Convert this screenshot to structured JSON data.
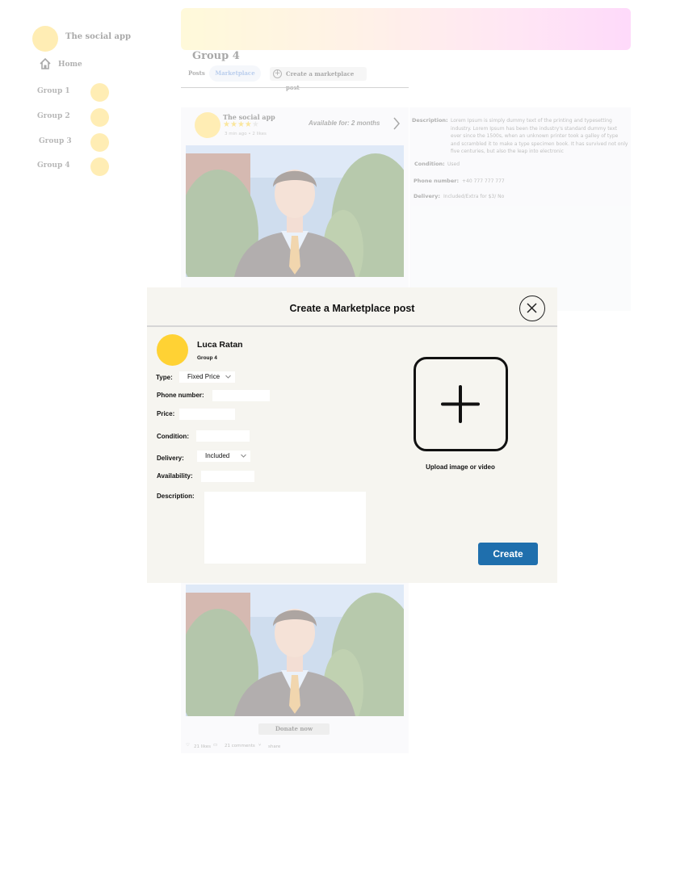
{
  "sidebar": {
    "app_name": "The social app",
    "home_label": "Home",
    "groups": [
      "Group 1",
      "Group 2",
      "Group 3",
      "Group 4"
    ]
  },
  "page": {
    "group_title": "Group 4",
    "tabs": {
      "posts": "Posts",
      "marketplace": "Marketplace",
      "create_marketplace_post": "Create a marketplace post"
    }
  },
  "post": {
    "author": "The social app",
    "rating": 4,
    "rating_max": 5,
    "meta": "3 min ago • 2 likes",
    "availability": "Available for: 2 months",
    "donate_label": "Donate now",
    "likes": "21 likes",
    "comments": "21 comments",
    "share": "share"
  },
  "details": {
    "description_label": "Description:",
    "description_value": "Lorem Ipsum is simply dummy text of the printing and typesetting industry. Lorem Ipsum has been the industry's standard dummy text ever since the 1500s, when an unknown printer took a galley of type and scrambled it to make a type specimen book. It has survived not only five centuries, but also the leap into electronic",
    "condition_label": "Condition:",
    "condition_value": "Used",
    "phone_label": "Phone number:",
    "phone_value": "+40 777 777 777",
    "delivery_label": "Delivery:",
    "delivery_value": "Included/Extra for $3/ No"
  },
  "modal": {
    "title": "Create a Marketplace post",
    "user_name": "Luca Ratan",
    "user_group": "Group 4",
    "type_label": "Type:",
    "type_value": "Fixed Price",
    "phone_label": "Phone number:",
    "phone_value": "",
    "price_label": "Price:",
    "price_value": "",
    "condition_label": "Condition:",
    "condition_value": "",
    "delivery_label": "Delivery:",
    "delivery_value": "Included",
    "availability_label": "Availability:",
    "availability_value": "",
    "description_label": "Description:",
    "description_value": "",
    "upload_label": "Upload image or video",
    "create_label": "Create"
  },
  "colors": {
    "accent_yellow": "#ffd234",
    "create_button": "#1f6fad",
    "banner_start": "#fff3a8",
    "banner_end": "#fca6f3"
  }
}
